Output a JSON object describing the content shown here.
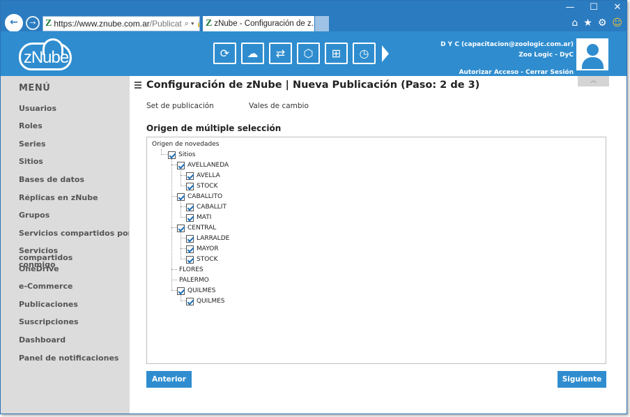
{
  "browser": {
    "url_host": "https://www.znube.com.ar",
    "url_path": "/Publicat",
    "tab_title": "zNube - Configuración de z...",
    "favicon": "Z"
  },
  "header": {
    "logo": "zNube",
    "user_line1": "D Y C (capacitacion@zoologic.com.ar)",
    "user_line2": "Zoo Logic - DyC",
    "authorize_link": "Autorizar Acceso",
    "separator": "-",
    "logout_link": "Cerrar Sesión",
    "tools": [
      "sync-icon",
      "cloud-settings-icon",
      "transfer-icon",
      "box-icon",
      "cart-icon",
      "clock-icon"
    ]
  },
  "sidebar": {
    "title": "MENÚ",
    "items": [
      "Usuarios",
      "Roles",
      "Series",
      "Sitios",
      "Bases de datos",
      "Réplicas en zNube",
      "Grupos",
      "Servicios compartidos por mí",
      "Servicios compartidos conmigo",
      "OneDrive",
      "e-Commerce",
      "Publicaciones",
      "Suscripciones",
      "Dashboard",
      "Panel de notificaciones"
    ]
  },
  "main": {
    "title": "Configuración de zNube | Nueva Publicación (Paso: 2 de 3)",
    "set_label": "Set de publicación",
    "set_value": "Vales de cambio",
    "section_title": "Origen de múltiple selección",
    "tree": {
      "root": "Origen de novedades",
      "sitios": "Sitios",
      "nodes": [
        {
          "label": "AVELLANEDA",
          "checked": true,
          "children": [
            {
              "label": "AVELLA",
              "checked": true
            },
            {
              "label": "STOCK",
              "checked": true
            }
          ]
        },
        {
          "label": "CABALLITO",
          "checked": true,
          "children": [
            {
              "label": "CABALLIT",
              "checked": true
            },
            {
              "label": "MATI",
              "checked": true
            }
          ]
        },
        {
          "label": "CENTRAL",
          "checked": true,
          "children": [
            {
              "label": "LARRALDE",
              "checked": true
            },
            {
              "label": "MAYOR",
              "checked": true
            },
            {
              "label": "STOCK",
              "checked": true
            }
          ]
        },
        {
          "label": "FLORES",
          "checked": false,
          "children": []
        },
        {
          "label": "PALERMO",
          "checked": false,
          "children": []
        },
        {
          "label": "QUILMES",
          "checked": true,
          "children": [
            {
              "label": "QUILMES",
              "checked": true
            }
          ]
        }
      ]
    },
    "prev_button": "Anterior",
    "next_button": "Siguiente"
  }
}
